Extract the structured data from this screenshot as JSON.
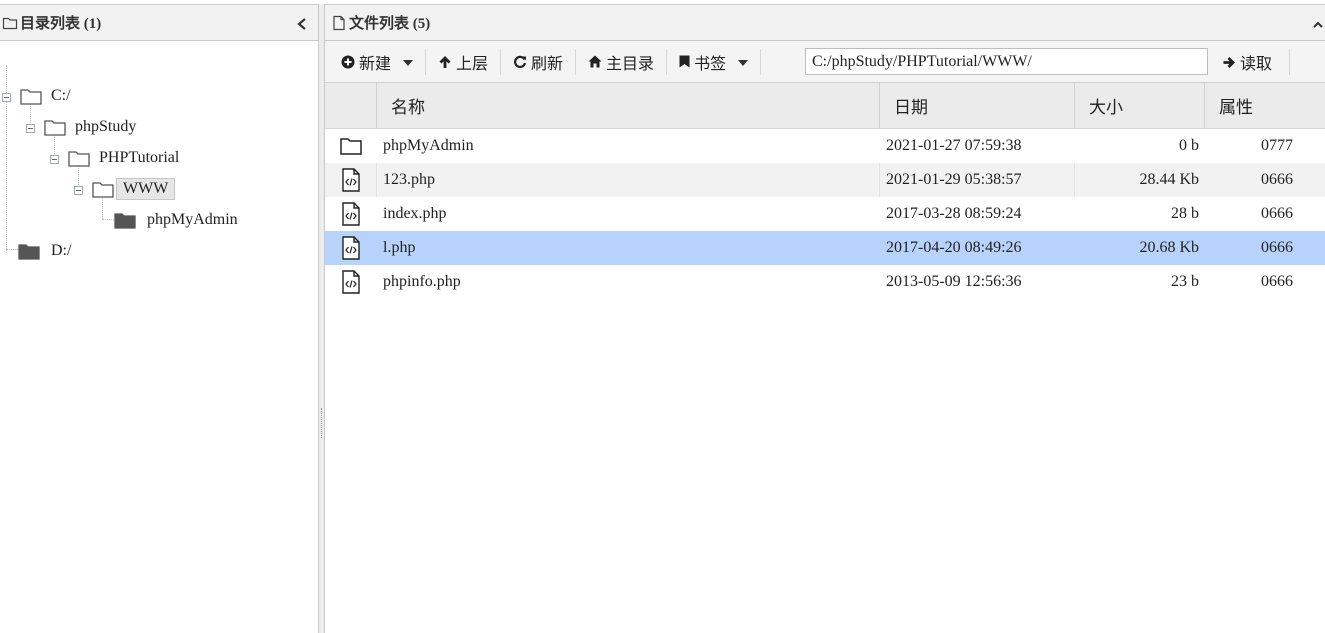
{
  "left_panel": {
    "title": "目录列表 (1)",
    "tree": [
      {
        "label": "C:/"
      },
      {
        "label": "phpStudy"
      },
      {
        "label": "PHPTutorial"
      },
      {
        "label": "WWW"
      },
      {
        "label": "phpMyAdmin"
      },
      {
        "label": "D:/"
      }
    ]
  },
  "right_panel": {
    "title": "文件列表 (5)",
    "toolbar": {
      "new_label": "新建",
      "up_label": "上层",
      "refresh_label": "刷新",
      "home_label": "主目录",
      "bookmark_label": "书签",
      "path_value": "C:/phpStudy/PHPTutorial/WWW/",
      "read_label": "读取"
    },
    "columns": [
      "名称",
      "日期",
      "大小",
      "属性"
    ],
    "rows": [
      {
        "icon": "folder-icon",
        "name": "phpMyAdmin",
        "date": "2021-01-27 07:59:38",
        "size": "0 b",
        "attr": "0777"
      },
      {
        "icon": "php-file-icon",
        "name": "123.php",
        "date": "2021-01-29 05:38:57",
        "size": "28.44 Kb",
        "attr": "0666"
      },
      {
        "icon": "php-file-icon",
        "name": "index.php",
        "date": "2017-03-28 08:59:24",
        "size": "28 b",
        "attr": "0666"
      },
      {
        "icon": "php-file-icon",
        "name": "l.php",
        "date": "2017-04-20 08:49:26",
        "size": "20.68 Kb",
        "attr": "0666"
      },
      {
        "icon": "php-file-icon",
        "name": "phpinfo.php",
        "date": "2013-05-09 12:56:36",
        "size": "23 b",
        "attr": "0666"
      }
    ]
  },
  "colors": {
    "selected_row": "#b7d3fb",
    "header_bg": "#f2f2f2"
  }
}
